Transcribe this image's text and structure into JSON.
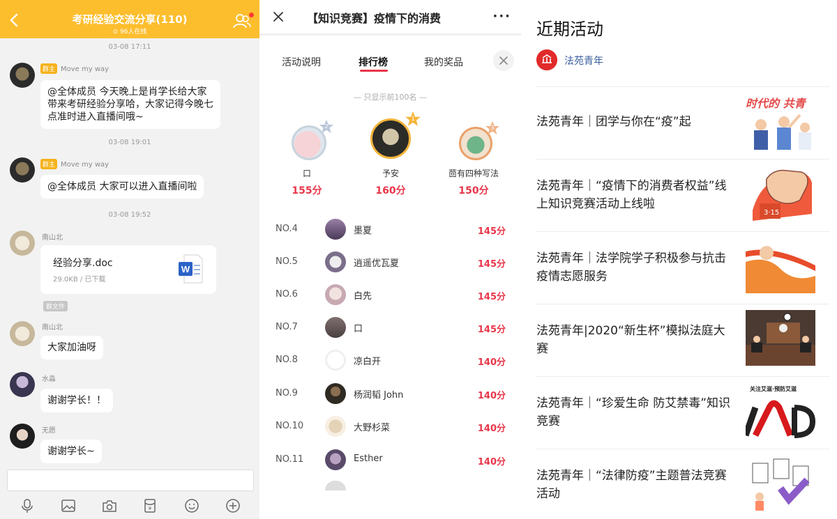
{
  "chat": {
    "title": "考研经验交流分享(110)",
    "online": "96人在线",
    "messages": [
      {
        "time": "03-08 17:11",
        "sender": "Move my way",
        "badge": "群主",
        "text": "@全体成员 今天晚上是肖学长给大家带来考研经验分享哈，大家记得今晚七点准时进入直播间哦~"
      },
      {
        "time": "03-08 19:01",
        "sender": "Move my way",
        "badge": "群主",
        "text": "@全体成员 大家可以进入直播间啦"
      },
      {
        "time": "03-08 19:52",
        "sender": "南山北",
        "file_name": "经验分享.doc",
        "file_meta": "29.0KB / 已下载",
        "file_tag": "群文件"
      },
      {
        "sender": "南山北",
        "text": "大家加油呀"
      },
      {
        "sender": "水淼",
        "text": "谢谢学长！！"
      },
      {
        "sender": "无愿",
        "text": "谢谢学长~"
      }
    ]
  },
  "quiz": {
    "title": "【知识竞赛】疫情下的消费",
    "tabs": [
      "活动说明",
      "排行榜",
      "我的奖品"
    ],
    "notice": "— 只显示前100名 —",
    "top3": [
      {
        "rank": 2,
        "name": "口",
        "score": "155分"
      },
      {
        "rank": 1,
        "name": "予安",
        "score": "160分"
      },
      {
        "rank": 3,
        "name": "茴有四种写法",
        "score": "150分"
      }
    ],
    "rows": [
      {
        "no": "NO.4",
        "name": "墨夏",
        "score": "145分"
      },
      {
        "no": "NO.5",
        "name": "逍遥优瓦夏",
        "score": "145分"
      },
      {
        "no": "NO.6",
        "name": "白先",
        "score": "145分"
      },
      {
        "no": "NO.7",
        "name": "口",
        "score": "145分"
      },
      {
        "no": "NO.8",
        "name": "凉白开",
        "score": "140分"
      },
      {
        "no": "NO.9",
        "name": "杨润韬 John",
        "score": "140分"
      },
      {
        "no": "NO.10",
        "name": "大野杉菜",
        "score": "140分"
      },
      {
        "no": "NO.11",
        "name": "Esther",
        "score": "140分"
      }
    ]
  },
  "news": {
    "title": "近期活动",
    "brand": "法苑青年",
    "items": [
      {
        "text": "法苑青年｜团学与你在“疫”起"
      },
      {
        "text": "法苑青年｜“疫情下的消费者权益”线上知识竞赛活动上线啦"
      },
      {
        "text": "法苑青年｜法学院学子积极参与抗击疫情志愿服务"
      },
      {
        "text": "法苑青年|2020“新生杯”模拟法庭大赛"
      },
      {
        "text": "法苑青年｜“珍爱生命 防艾禁毒”知识竞赛"
      },
      {
        "text": "法苑青年｜“法律防疫”主题普法竞赛活动"
      }
    ],
    "thumb_texts": {
      "0": "时代的 共青",
      "4": "关注艾滋·预防艾滋"
    }
  }
}
